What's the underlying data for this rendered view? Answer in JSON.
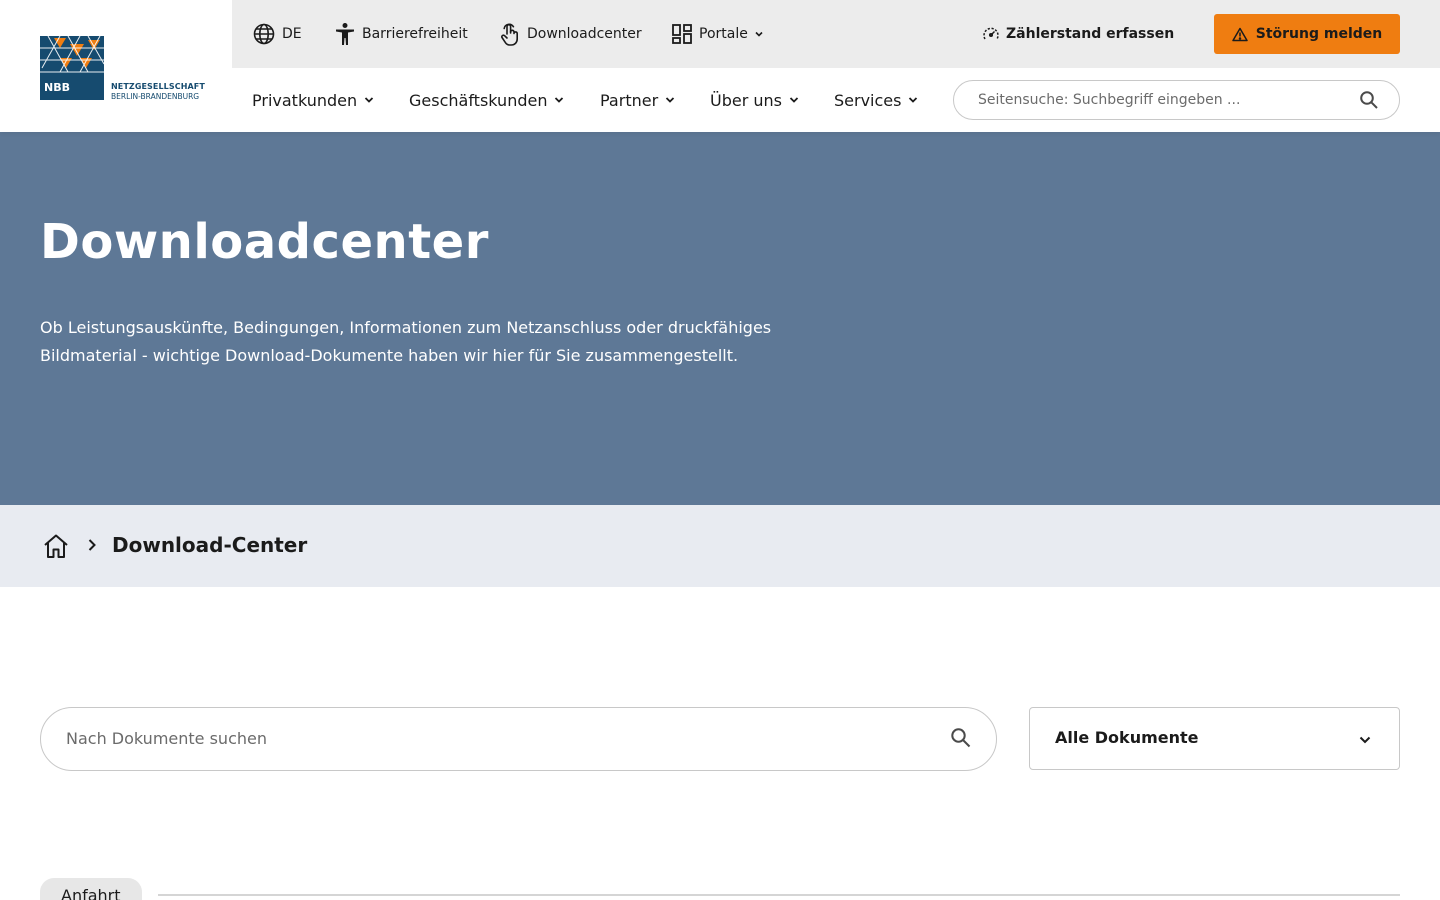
{
  "logo": {
    "badge_text": "NBB",
    "line1": "NETZGESELLSCHAFT",
    "line2": "BERLIN-BRANDENBURG",
    "colors": {
      "navy": "#164b6f",
      "orange": "#ef7d11"
    }
  },
  "topbar": {
    "language": "DE",
    "accessibility": "Barrierefreiheit",
    "downloadcenter": "Downloadcenter",
    "portale": "Portale",
    "meter": "Zählerstand erfassen",
    "report": "Störung melden"
  },
  "nav": {
    "items": [
      {
        "label": "Privatkunden"
      },
      {
        "label": "Geschäftskunden"
      },
      {
        "label": "Partner"
      },
      {
        "label": "Über uns"
      },
      {
        "label": "Services"
      }
    ]
  },
  "site_search": {
    "placeholder": "Seitensuche: Suchbegriff eingeben ..."
  },
  "hero": {
    "title": "Downloadcenter",
    "description": "Ob Leistungsauskünfte, Bedingungen, Informationen zum Netzanschluss oder druckfähiges Bildmaterial - wichtige Download-Dokumente haben wir hier für Sie zusammengestellt.",
    "background_color": "#5e7896"
  },
  "breadcrumb": {
    "current": "Download-Center"
  },
  "filters": {
    "search_placeholder": "Nach Dokumente suchen",
    "select_value": "Alle Dokumente"
  },
  "categories": [
    {
      "label": "Anfahrt"
    }
  ]
}
